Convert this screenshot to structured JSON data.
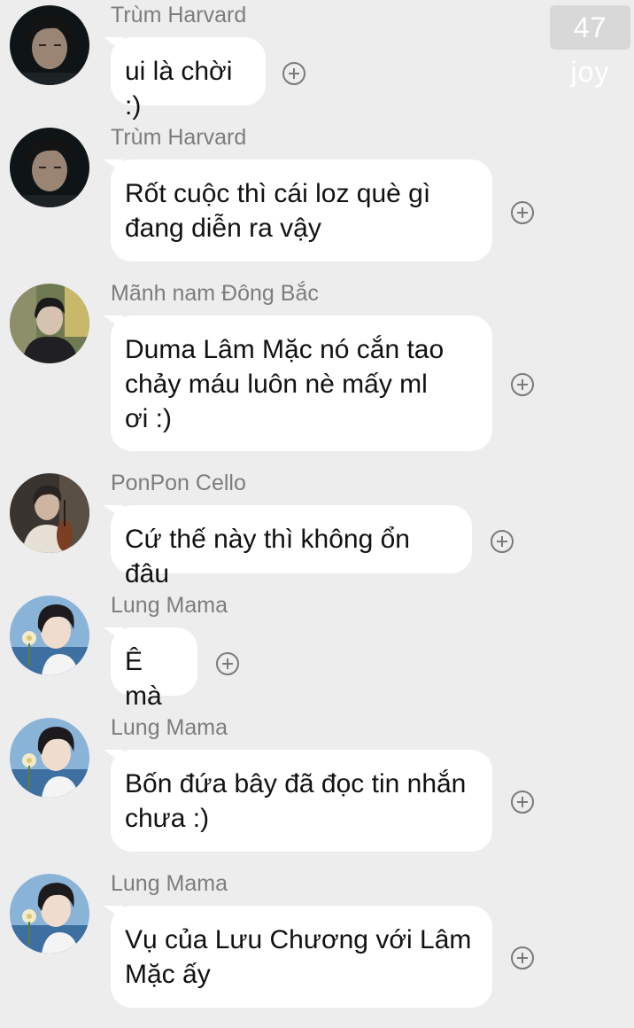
{
  "watermark": "47 joy",
  "messages": [
    {
      "sender": "Trùm Harvard",
      "text": "ui là chời :)",
      "avatar": "avatar-dark-hair-boy"
    },
    {
      "sender": "Trùm Harvard",
      "text": "Rốt cuộc thì cái loz què gì\nđang diễn ra vậy",
      "avatar": "avatar-dark-hair-boy"
    },
    {
      "sender": "Mãnh nam Đông Bắc",
      "text": "Duma Lâm Mặc nó cắn tao\nchảy máu luôn nè mấy ml\nơi :)",
      "avatar": "avatar-boy-outdoor"
    },
    {
      "sender": "PonPon Cello",
      "text": "Cứ thế này thì không ổn đâu",
      "avatar": "avatar-cello-player"
    },
    {
      "sender": "Lung Mama",
      "text": "Ê mà",
      "avatar": "avatar-boy-with-flower"
    },
    {
      "sender": "Lung Mama",
      "text": "Bốn đứa bây đã đọc tin nhắn\nchưa :)",
      "avatar": "avatar-boy-with-flower"
    },
    {
      "sender": "Lung Mama",
      "text": "Vụ của Lưu Chương với Lâm\nMặc ấy",
      "avatar": "avatar-boy-with-flower"
    }
  ],
  "icons": {
    "reaction": "add-reaction-icon"
  },
  "colors": {
    "background": "#ededed",
    "bubble": "#ffffff",
    "sender": "#7d7d7d"
  }
}
